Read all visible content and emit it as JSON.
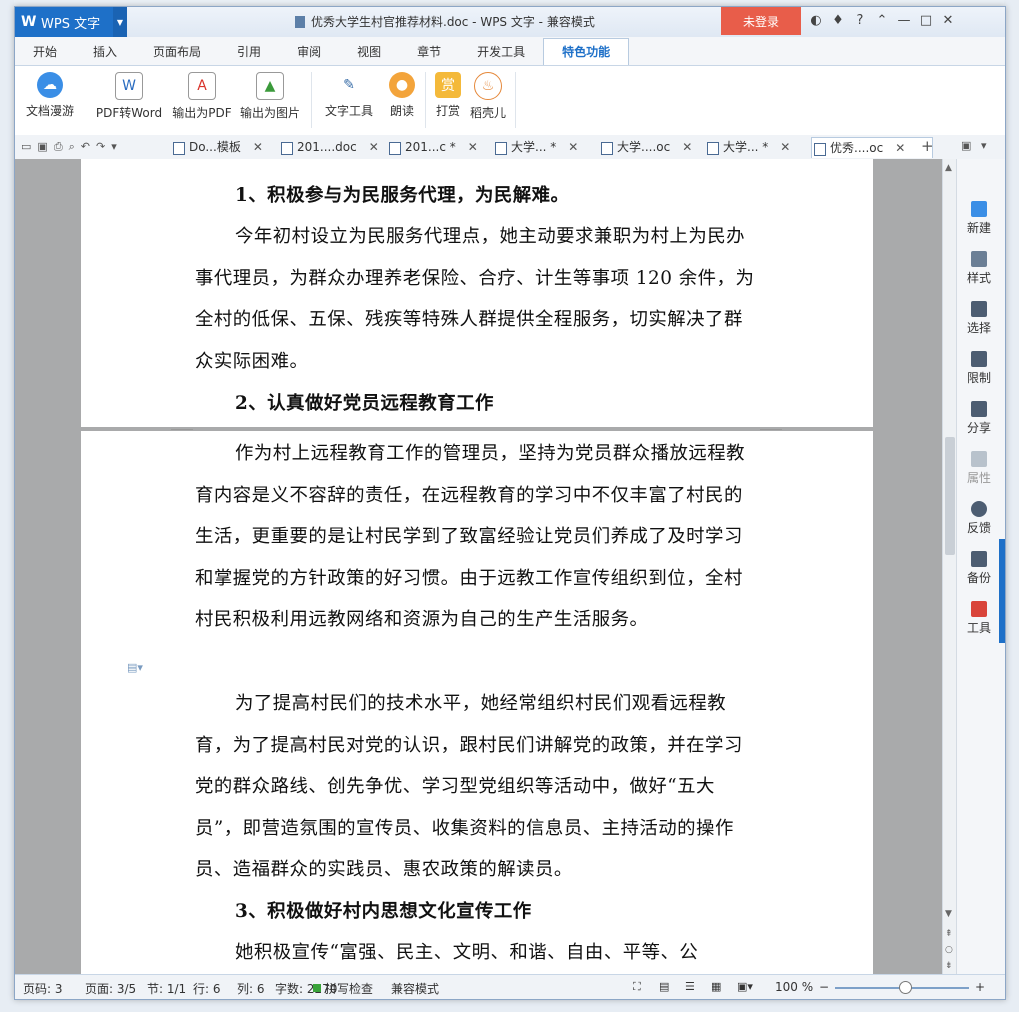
{
  "app": {
    "name": "WPS 文字",
    "window_title": "优秀大学生村官推荐材料.doc - WPS 文字 - 兼容模式",
    "login": "未登录"
  },
  "menu_tabs": [
    "开始",
    "插入",
    "页面布局",
    "引用",
    "审阅",
    "视图",
    "章节",
    "开发工具",
    "特色功能"
  ],
  "active_tab": "特色功能",
  "ribbon": {
    "btn1": "文档漫游",
    "btn2": "PDF转Word",
    "btn3": "输出为PDF",
    "btn4": "输出为图片",
    "btn5": "文字工具",
    "btn6": "朗读",
    "btn7": "打赏",
    "btn8": "稻壳儿",
    "reward_glyph": "赏"
  },
  "doc_tabs": {
    "t1": "Do...模板",
    "t2": "201....doc",
    "t3": "201...c *",
    "t4": "大学... *",
    "t5": "大学....oc",
    "t6": "大学... *",
    "t7": "优秀....oc"
  },
  "document": {
    "h1": "1、积极参与为民服务代理，为民解难。",
    "p1": "今年初村设立为民服务代理点，她主动要求兼职为村上为民办事代理员，为群众办理养老保险、合疗、计生等事项 120 余件，为全村的低保、五保、残疾等特殊人群提供全程服务，切实解决了群众实际困难。",
    "h2": "2、认真做好党员远程教育工作",
    "p2": "作为村上远程教育工作的管理员，坚持为党员群众播放远程教育内容是义不容辞的责任，在远程教育的学习中不仅丰富了村民的生活，更重要的是让村民学到了致富经验让党员们养成了及时学习和掌握党的方针政策的好习惯。由于远教工作宣传组织到位，全村村民积极利用远教网络和资源为自己的生产生活服务。",
    "p3": "为了提高村民们的技术水平，她经常组织村民们观看远程教育，为了提高村民对党的认识，跟村民们讲解党的政策，并在学习党的群众路线、创先争优、学习型党组织等活动中，做好“五大员”，即营造氛围的宣传员、收集资料的信息员、主持活动的操作员、造福群众的实践员、惠农政策的解读员。",
    "h3": "3、积极做好村内思想文化宣传工作",
    "p4": "她积极宣传“富强、民主、文明、和谐、自由、平等、公"
  },
  "sidebar": {
    "b1": "新建",
    "b2": "样式",
    "b3": "选择",
    "b4": "限制",
    "b5": "分享",
    "b6": "属性",
    "b7": "反馈",
    "b8": "备份",
    "b9": "工具"
  },
  "status": {
    "page_code": "页码: 3",
    "pages": "页面: 3/5",
    "section": "节: 1/1",
    "row": "行: 6",
    "col": "列: 6",
    "words": "字数: 2270",
    "spell": "拼写检查",
    "mode": "兼容模式",
    "zoom": "100 %"
  },
  "colors": {
    "accent": "#1e70c8",
    "login": "#e85d4a"
  }
}
